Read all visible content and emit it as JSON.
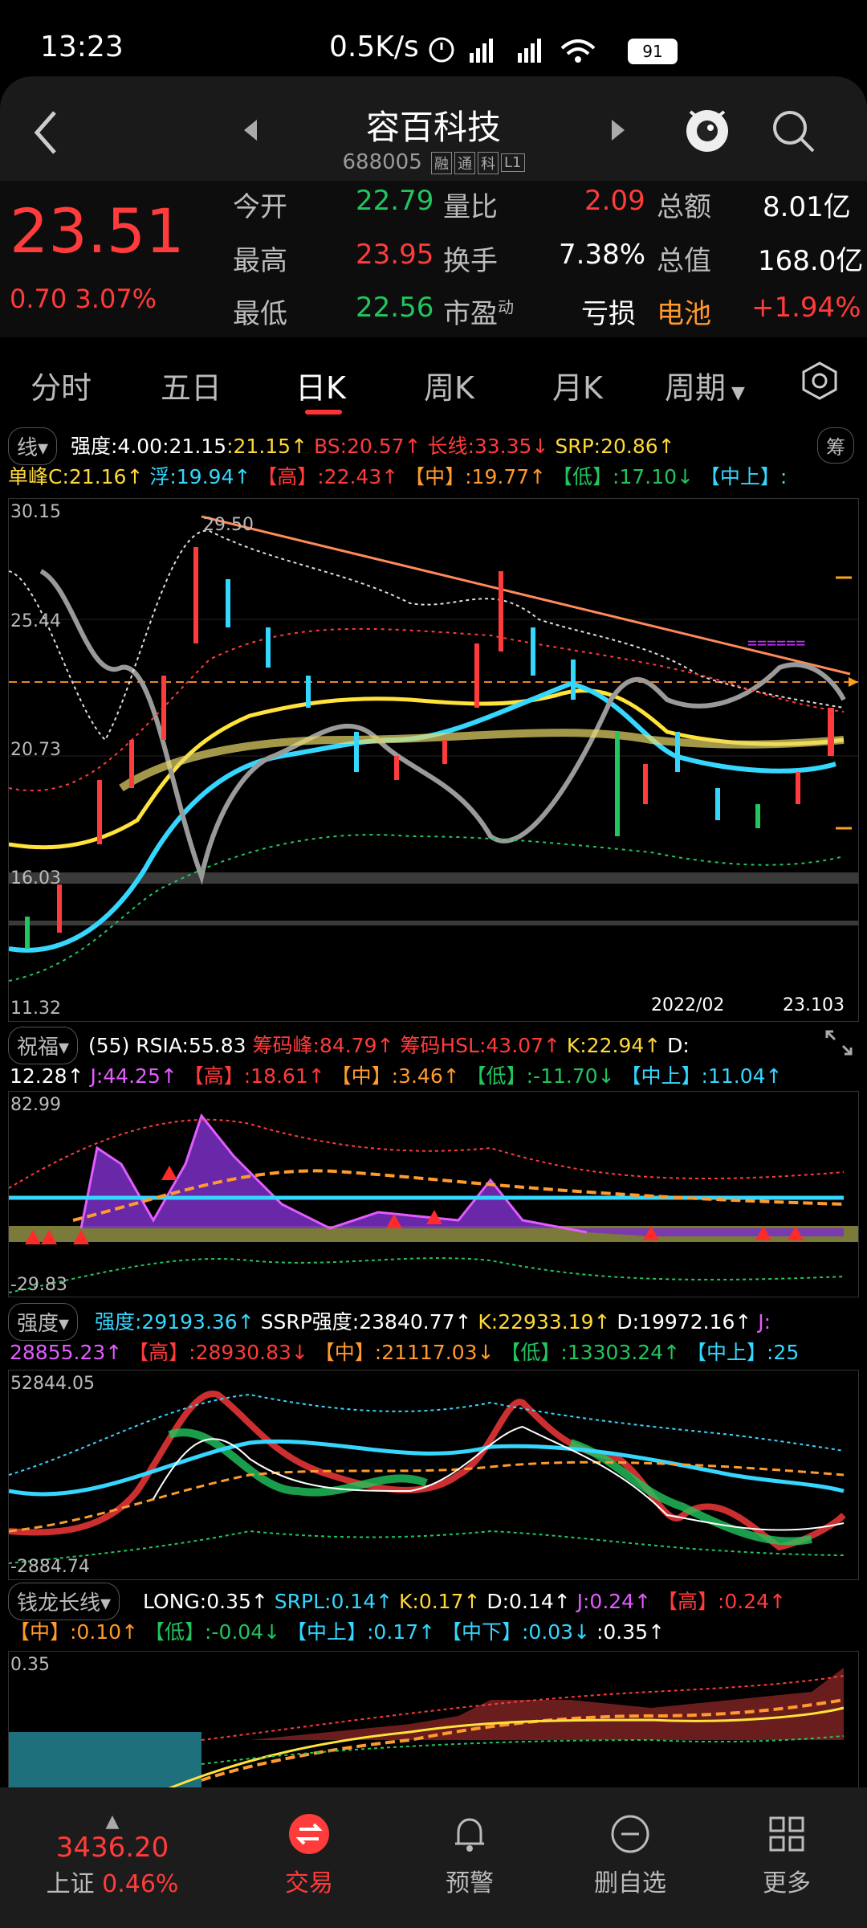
{
  "status_bar": {
    "time": "13:23",
    "net_speed": "0.5K/s",
    "battery": "91"
  },
  "header": {
    "title": "容百科技",
    "code": "688005",
    "tags": [
      "融",
      "通",
      "科",
      "L1"
    ]
  },
  "quote": {
    "price": "23.51",
    "change": "0.70",
    "change_pct": "3.07%",
    "rows": [
      {
        "l1": "今开",
        "v1": "22.79",
        "l2": "量比",
        "v2": "2.09",
        "l3": "总额",
        "v3": "8.01亿"
      },
      {
        "l1": "最高",
        "v1": "23.95",
        "l2": "换手",
        "v2": "7.38%",
        "l3": "总值",
        "v3": "168.0亿"
      },
      {
        "l1": "最低",
        "v1": "22.56",
        "l2": "市盈",
        "l2sup": "动",
        "v2": "亏损",
        "l3": "电池",
        "v3": "+1.94%"
      }
    ]
  },
  "tabs": [
    "分时",
    "五日",
    "日K",
    "周K",
    "月K",
    "周期"
  ],
  "main_indicator": {
    "selector": "线",
    "chip": "筹",
    "line1": [
      [
        "强度:4.00",
        "white"
      ],
      [
        ":21.15",
        "white"
      ],
      [
        ":21.15↑",
        "yellow"
      ],
      [
        " BS:20.57↑",
        "red"
      ],
      [
        " 长线:33.35↓",
        "red"
      ],
      [
        " SRP:20.86↑",
        "yellow"
      ]
    ],
    "line2": [
      [
        "单峰C:21.16↑",
        "yellow"
      ],
      [
        " 浮:19.94↑",
        "cyan"
      ],
      [
        " 【高】:22.43↑",
        "red"
      ],
      [
        " 【中】:19.77↑",
        "orange"
      ],
      [
        " 【低】:17.10↓",
        "green"
      ],
      [
        " 【中上】:",
        "cyan"
      ]
    ],
    "axis": [
      "30.15",
      "25.44",
      "20.73",
      "16.03",
      "11.32"
    ],
    "peak": "29.50",
    "date": "2022/02",
    "last": "23.103"
  },
  "sub1": {
    "selector": "祝福",
    "line1": [
      [
        "(55) RSIA:55.83",
        "white"
      ],
      [
        " 筹码峰:84.79↑",
        "red"
      ],
      [
        " 筹码HSL:43.07↑",
        "red"
      ],
      [
        " K:22.94↑",
        "yellow"
      ],
      [
        " D:",
        "white"
      ]
    ],
    "line2": [
      [
        "12.28↑",
        "white"
      ],
      [
        " J:44.25↑",
        "magenta"
      ],
      [
        " 【高】:18.61↑",
        "red"
      ],
      [
        " 【中】:3.46↑",
        "orange"
      ],
      [
        " 【低】:-11.70↓",
        "green"
      ],
      [
        " 【中上】:11.04↑",
        "cyan"
      ]
    ],
    "axis": [
      "82.99",
      "-29.83"
    ]
  },
  "sub2": {
    "selector": "强度",
    "line1": [
      [
        "强度:29193.36↑",
        "cyan"
      ],
      [
        " SSRP强度:23840.77↑",
        "white"
      ],
      [
        " K:22933.19↑",
        "yellow"
      ],
      [
        " D:19972.16↑",
        "white"
      ],
      [
        " J:",
        "magenta"
      ]
    ],
    "line2": [
      [
        "28855.23↑",
        "magenta"
      ],
      [
        " 【高】:28930.83↓",
        "red"
      ],
      [
        " 【中】:21117.03↓",
        "orange"
      ],
      [
        " 【低】:13303.24↑",
        "green"
      ],
      [
        " 【中上】:25",
        "cyan"
      ]
    ],
    "axis": [
      "52844.05",
      "-2884.74"
    ]
  },
  "sub3": {
    "selector": "钱龙长线",
    "line1": [
      [
        "LONG:0.35↑",
        "white"
      ],
      [
        " SRPL:0.14↑",
        "cyan"
      ],
      [
        " K:0.17↑",
        "yellow"
      ],
      [
        " D:0.14↑",
        "white"
      ],
      [
        " J:0.24↑",
        "magenta"
      ],
      [
        " 【高】:0.24↑",
        "red"
      ]
    ],
    "line2": [
      [
        "【中】:0.10↑",
        "orange"
      ],
      [
        " 【低】:-0.04↓",
        "green"
      ],
      [
        " 【中上】:0.17↑",
        "cyan"
      ],
      [
        " 【中下】:0.03↓",
        "cyan"
      ],
      [
        " :0.35↑",
        "white"
      ]
    ],
    "axis": [
      "0.35"
    ]
  },
  "bottom_bar": {
    "index_value": "3436.20",
    "index_name": "上证",
    "index_pct": "0.46%",
    "items": [
      "交易",
      "预警",
      "删自选",
      "更多"
    ]
  }
}
